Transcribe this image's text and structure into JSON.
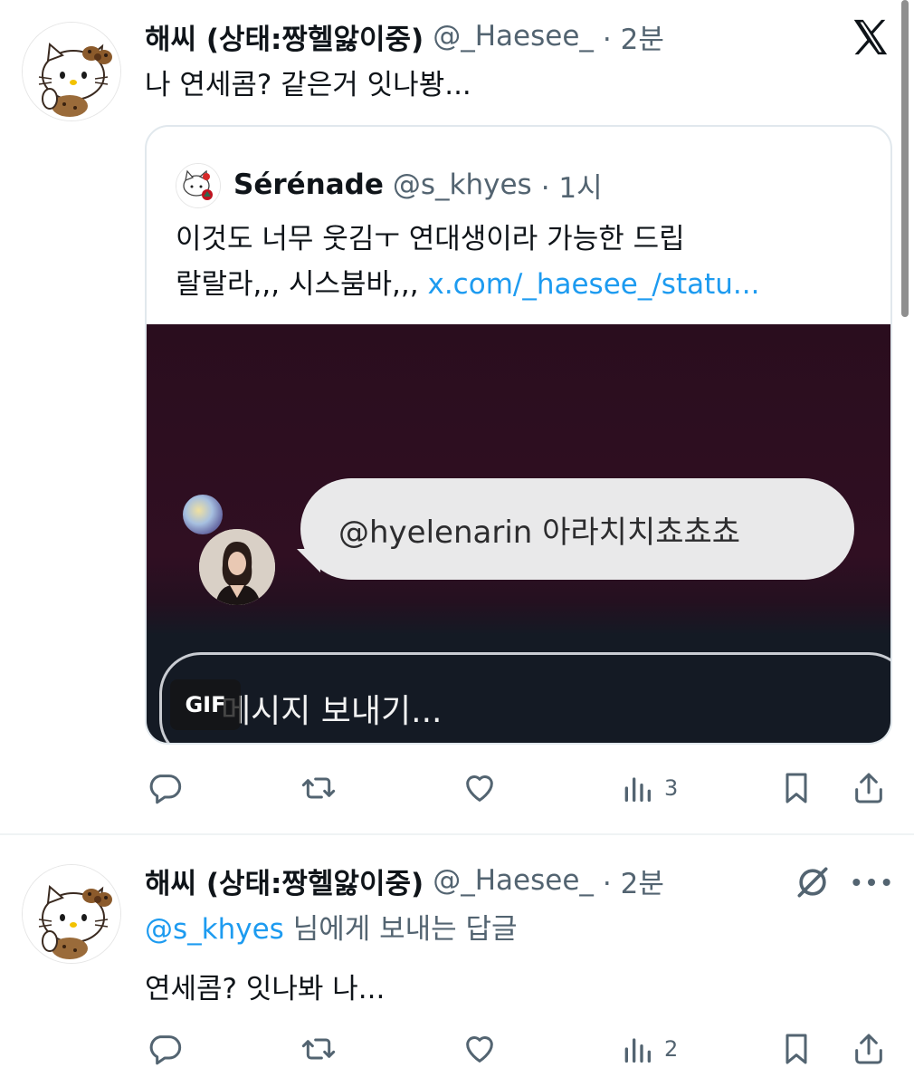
{
  "tweet1": {
    "author_name": "해씨 (상태:짱헬앓이중)",
    "handle": "@_Haesee_",
    "time": "· 2분",
    "text": "나 연세콤? 같은거 잇나봥...",
    "quote": {
      "author_name": "Sérénade",
      "handle": "@s_khyes",
      "time": "· 1시",
      "line1": "이것도 너무 웃김ㅜ 연대생이라 가능한 드립",
      "line2": "랄랄라,,, 시스붐바,,,",
      "link": "x.com/_haesee_/statu...",
      "media": {
        "bubble_text": "@hyelenarin 아라치치쵸쵸쵸",
        "input_placeholder": "메시지 보내기...",
        "gif_label": "GIF"
      }
    },
    "views_count": "3"
  },
  "tweet2": {
    "author_name": "해씨 (상태:짱헬앓이중)",
    "handle": "@_Haesee_",
    "time": "· 2분",
    "reply_to_handle": "@s_khyes",
    "reply_to_suffix": "님에게 보내는 답글",
    "text": "연세콤? 잇나봐 나...",
    "views_count": "2"
  },
  "colors": {
    "link": "#1d9bf0",
    "secondary_text": "#536471",
    "primary_text": "#0f1419"
  },
  "icons": [
    "x-logo-icon",
    "reply-icon",
    "retweet-icon",
    "like-icon",
    "views-icon",
    "bookmark-icon",
    "share-icon",
    "muted-icon",
    "more-icon"
  ]
}
